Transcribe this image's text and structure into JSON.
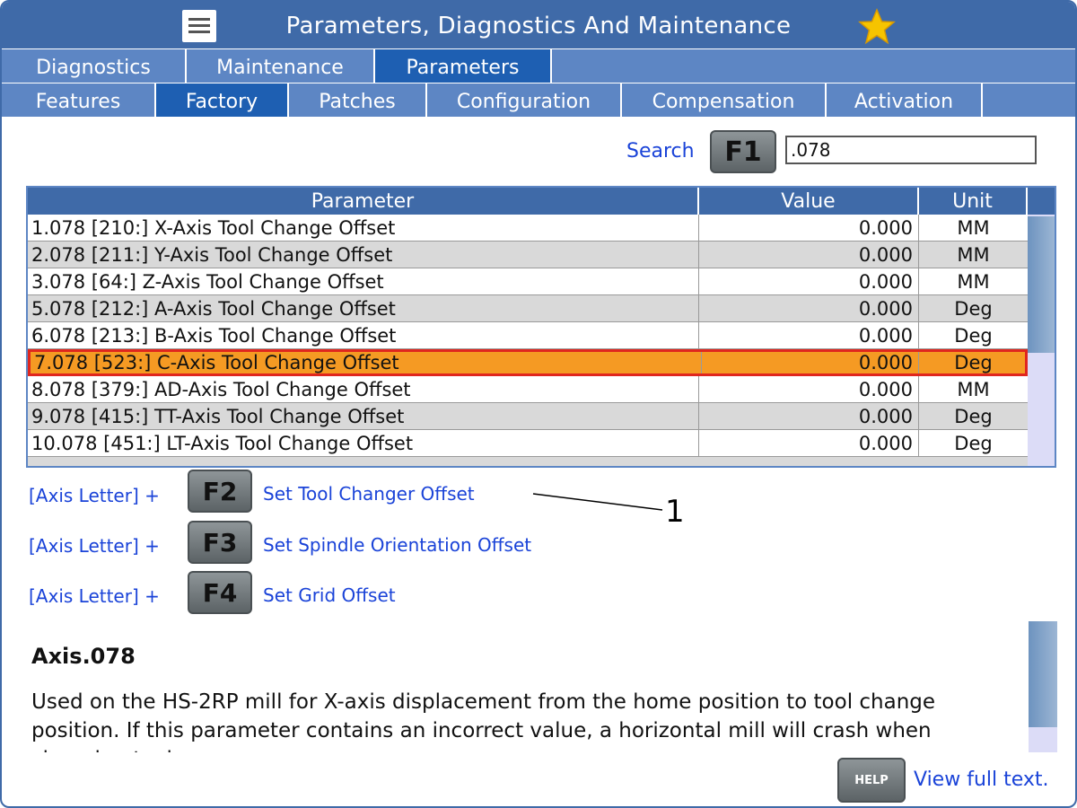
{
  "title": "Parameters, Diagnostics And Maintenance",
  "tabs_top": [
    {
      "label": "Diagnostics"
    },
    {
      "label": "Maintenance"
    },
    {
      "label": "Parameters"
    }
  ],
  "tabs_sub": [
    {
      "label": "Features"
    },
    {
      "label": "Factory"
    },
    {
      "label": "Patches"
    },
    {
      "label": "Configuration"
    },
    {
      "label": "Compensation"
    },
    {
      "label": "Activation"
    }
  ],
  "active_top_tab": "Parameters",
  "active_sub_tab": "Factory",
  "search": {
    "label": "Search",
    "key": "F1",
    "value": ".078"
  },
  "table": {
    "headers": {
      "parameter": "Parameter",
      "value": "Value",
      "unit": "Unit"
    },
    "rows": [
      {
        "parameter": "1.078 [210:] X-Axis Tool Change Offset",
        "value": "0.000",
        "unit": "MM"
      },
      {
        "parameter": "2.078 [211:] Y-Axis Tool Change Offset",
        "value": "0.000",
        "unit": "MM"
      },
      {
        "parameter": "3.078 [64:] Z-Axis Tool Change Offset",
        "value": "0.000",
        "unit": "MM"
      },
      {
        "parameter": "5.078 [212:] A-Axis Tool Change Offset",
        "value": "0.000",
        "unit": "Deg"
      },
      {
        "parameter": "6.078 [213:] B-Axis Tool Change Offset",
        "value": "0.000",
        "unit": "Deg"
      },
      {
        "parameter": "7.078 [523:] C-Axis Tool Change Offset",
        "value": "0.000",
        "unit": "Deg"
      },
      {
        "parameter": "8.078 [379:] AD-Axis Tool Change Offset",
        "value": "0.000",
        "unit": "MM"
      },
      {
        "parameter": "9.078 [415:] TT-Axis Tool Change Offset",
        "value": "0.000",
        "unit": "Deg"
      },
      {
        "parameter": "10.078 [451:] LT-Axis Tool Change Offset",
        "value": "0.000",
        "unit": "Deg"
      }
    ],
    "selected_row": 5
  },
  "function_keys": [
    {
      "prefix": "[Axis Letter] +",
      "key": "F2",
      "description": "Set Tool Changer Offset"
    },
    {
      "prefix": "[Axis Letter] +",
      "key": "F3",
      "description": "Set Spindle Orientation Offset"
    },
    {
      "prefix": "[Axis Letter] +",
      "key": "F4",
      "description": "Set Grid Offset"
    }
  ],
  "callout": "1",
  "description": {
    "title": "Axis.078",
    "text": "Used on the HS-2RP mill for X-axis displacement from the home position to tool change position. If this parameter contains an incorrect value, a horizontal mill will crash when changing tools."
  },
  "help": {
    "key": "HELP",
    "link": "View full text."
  },
  "colors": {
    "header_blue": "#3f6aa8",
    "tab_blue": "#5d86c4",
    "active_tab": "#1e5fb2",
    "selected_row": "#f59a23",
    "selected_border": "#e0261e",
    "link_blue": "#1a43d8",
    "star": "#f6c400"
  },
  "icons": {
    "menu": "hamburger-menu-icon",
    "favorite": "star-icon"
  }
}
